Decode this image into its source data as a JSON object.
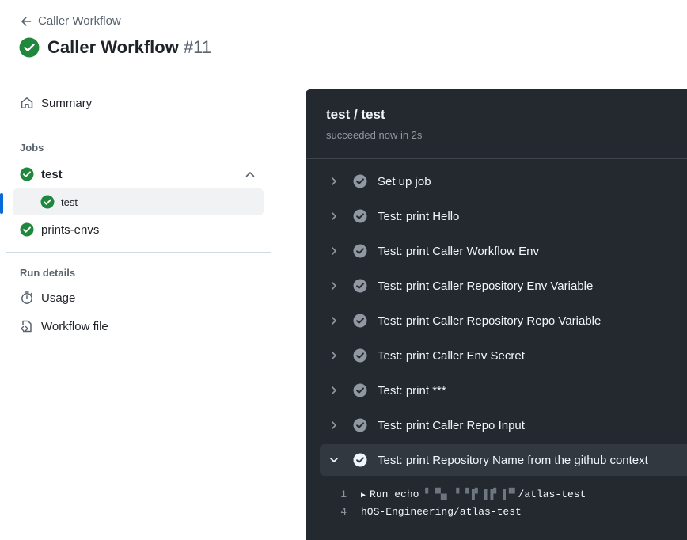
{
  "header": {
    "back_label": "Caller Workflow",
    "title": "Caller Workflow",
    "run_number": "#11"
  },
  "sidebar": {
    "summary_label": "Summary",
    "jobs_label": "Jobs",
    "jobs": [
      {
        "label": "test",
        "sub": [
          {
            "label": "test"
          }
        ]
      },
      {
        "label": "prints-envs"
      }
    ],
    "run_details_label": "Run details",
    "usage_label": "Usage",
    "workflow_file_label": "Workflow file"
  },
  "panel": {
    "title": "test / test",
    "subtitle": "succeeded now in 2s",
    "steps": [
      "Set up job",
      "Test: print Hello",
      "Test: print Caller Workflow Env",
      "Test: print Caller Repository Env Variable",
      "Test: print Caller Repository Repo Variable",
      "Test: print Caller Env Secret",
      "Test: print ***",
      "Test: print Caller Repo Input",
      "Test: print Repository Name from the github context"
    ],
    "log": [
      {
        "num": "1",
        "prefix": "Run echo ",
        "redacted_a": "▘▝▚▖",
        "redacted_b": "▘▝▐▘▐▐▘▐▝▘",
        "suffix": "/atlas-test"
      },
      {
        "num": "4",
        "text": "hOS-Engineering/atlas-test"
      }
    ]
  },
  "colors": {
    "success": "#1f883d",
    "panel_bg": "#24292f",
    "accent": "#0969da"
  }
}
